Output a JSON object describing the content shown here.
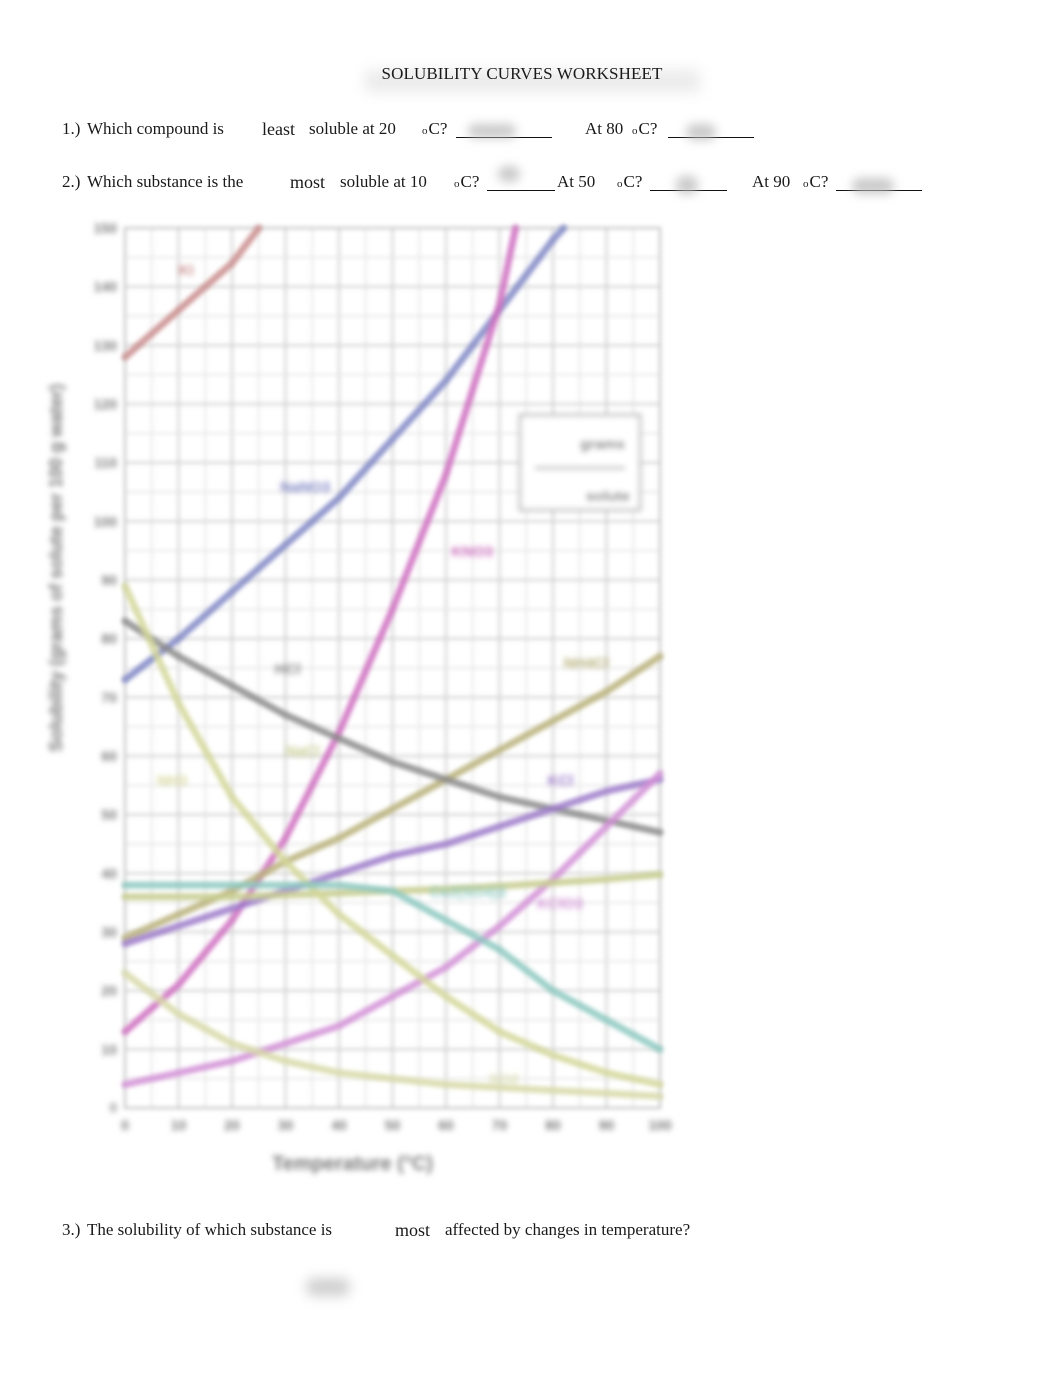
{
  "header": {
    "title": "SOLUBILITY CURVES WORKSHEET"
  },
  "questions": [
    {
      "number": "1.)",
      "text_before": "Which compound is",
      "emphasis": "least",
      "text_after": "soluble at 20",
      "unit": "C?",
      "degree": "o",
      "answer_blank": "",
      "followups": [
        {
          "label": "At 80",
          "degree": "o",
          "unit": "C?",
          "answer_blank": ""
        }
      ]
    },
    {
      "number": "2.)",
      "text_before": "Which substance is the",
      "emphasis": "most",
      "text_after": "soluble at 10",
      "unit": "C?",
      "degree": "o",
      "answer_blank": "",
      "followups": [
        {
          "label": "At 50",
          "degree": "o",
          "unit": "C?",
          "answer_blank": ""
        },
        {
          "label": "At 90",
          "degree": "o",
          "unit": "C?",
          "answer_blank": ""
        }
      ]
    },
    {
      "number": "3.)",
      "text_before": "The solubility of which substance is",
      "emphasis": "most",
      "text_after": "affected by changes in temperature?",
      "answer_blank": ""
    }
  ],
  "chart_data": {
    "type": "line",
    "title": "",
    "xlabel": "Temperature (°C)",
    "ylabel": "Solubility (grams of solute per 100 g water)",
    "xlim": [
      0,
      100
    ],
    "ylim": [
      0,
      150
    ],
    "x_ticks": [
      "0",
      "10",
      "20",
      "30",
      "40",
      "50",
      "60",
      "70",
      "80",
      "90",
      "100"
    ],
    "y_ticks": [
      "0",
      "10",
      "20",
      "30",
      "40",
      "50",
      "60",
      "70",
      "80",
      "90",
      "100",
      "110",
      "120",
      "130",
      "140",
      "150"
    ],
    "grid": true,
    "legend_box": {
      "top_label": "grams",
      "bottom_label": "solute",
      "position": "upper-right"
    },
    "series": [
      {
        "name": "KI",
        "color": "#c98c8c",
        "label_at": [
          10,
          142
        ],
        "x": [
          0,
          10,
          20,
          25
        ],
        "y": [
          128,
          136,
          144,
          150
        ]
      },
      {
        "name": "NaNO3",
        "color": "#7f86c4",
        "label_at": [
          29,
          105
        ],
        "x": [
          0,
          10,
          20,
          30,
          40,
          50,
          60,
          70,
          80,
          82
        ],
        "y": [
          73,
          80,
          88,
          96,
          104,
          114,
          124,
          136,
          148,
          150
        ]
      },
      {
        "name": "KNO3",
        "color": "#cf6fbf",
        "label_at": [
          61,
          94
        ],
        "x": [
          0,
          10,
          20,
          30,
          40,
          50,
          60,
          70,
          73
        ],
        "y": [
          13,
          21,
          32,
          46,
          64,
          85,
          108,
          137,
          150
        ]
      },
      {
        "name": "NH4Cl",
        "color": "#b8b07a",
        "label_at": [
          82,
          75
        ],
        "x": [
          0,
          10,
          20,
          30,
          40,
          50,
          60,
          70,
          80,
          90,
          100
        ],
        "y": [
          29,
          33,
          37,
          42,
          46,
          51,
          56,
          61,
          66,
          71,
          77
        ]
      },
      {
        "name": "HCl",
        "color": "#8a8a8a",
        "label_at": [
          28,
          74
        ],
        "x": [
          0,
          10,
          20,
          30,
          40,
          50,
          60,
          70,
          80,
          90,
          100
        ],
        "y": [
          83,
          77,
          72,
          67,
          63,
          59,
          56,
          53,
          51,
          49,
          47
        ]
      },
      {
        "name": "KCl",
        "color": "#9c7ac9",
        "label_at": [
          79,
          55
        ],
        "x": [
          0,
          10,
          20,
          30,
          40,
          50,
          60,
          70,
          80,
          90,
          100
        ],
        "y": [
          28,
          31,
          34,
          37,
          40,
          43,
          45,
          48,
          51,
          54,
          56
        ]
      },
      {
        "name": "KClO3",
        "color": "#d28fd6",
        "label_at": [
          77,
          34
        ],
        "x": [
          0,
          10,
          20,
          30,
          40,
          50,
          60,
          70,
          80,
          90,
          100
        ],
        "y": [
          4,
          6,
          8,
          11,
          14,
          19,
          24,
          31,
          39,
          48,
          57
        ]
      },
      {
        "name": "NaCl",
        "color": "#c7cc8e",
        "label_at": [
          30,
          60
        ],
        "x": [
          0,
          10,
          20,
          30,
          40,
          50,
          60,
          70,
          80,
          90,
          100
        ],
        "y": [
          36,
          36,
          36,
          36.3,
          36.6,
          37,
          37.3,
          37.8,
          38.4,
          39,
          39.8
        ]
      },
      {
        "name": "NH3",
        "color": "#d4d79a",
        "label_at": [
          6,
          55
        ],
        "x": [
          0,
          10,
          20,
          30,
          40,
          50,
          60,
          70,
          80,
          90,
          100
        ],
        "y": [
          89,
          69,
          53,
          42,
          33,
          26,
          19,
          13,
          9,
          6,
          4
        ]
      },
      {
        "name": "SO2",
        "color": "#d7d9a8",
        "label_at": [
          68,
          4
        ],
        "x": [
          0,
          10,
          20,
          30,
          40,
          50,
          60,
          70,
          80,
          90,
          100
        ],
        "y": [
          23,
          16,
          11,
          8,
          6,
          5,
          4,
          3.5,
          3,
          2.5,
          2
        ]
      },
      {
        "name": "Ce2(SO4)3",
        "color": "#8cc8c0",
        "label_at": [
          57,
          36
        ],
        "x": [
          0,
          10,
          20,
          30,
          40,
          50,
          60,
          70,
          80,
          90,
          100
        ],
        "y": [
          38,
          38,
          38,
          38,
          38,
          37,
          32,
          27,
          20,
          15,
          10
        ]
      }
    ]
  }
}
